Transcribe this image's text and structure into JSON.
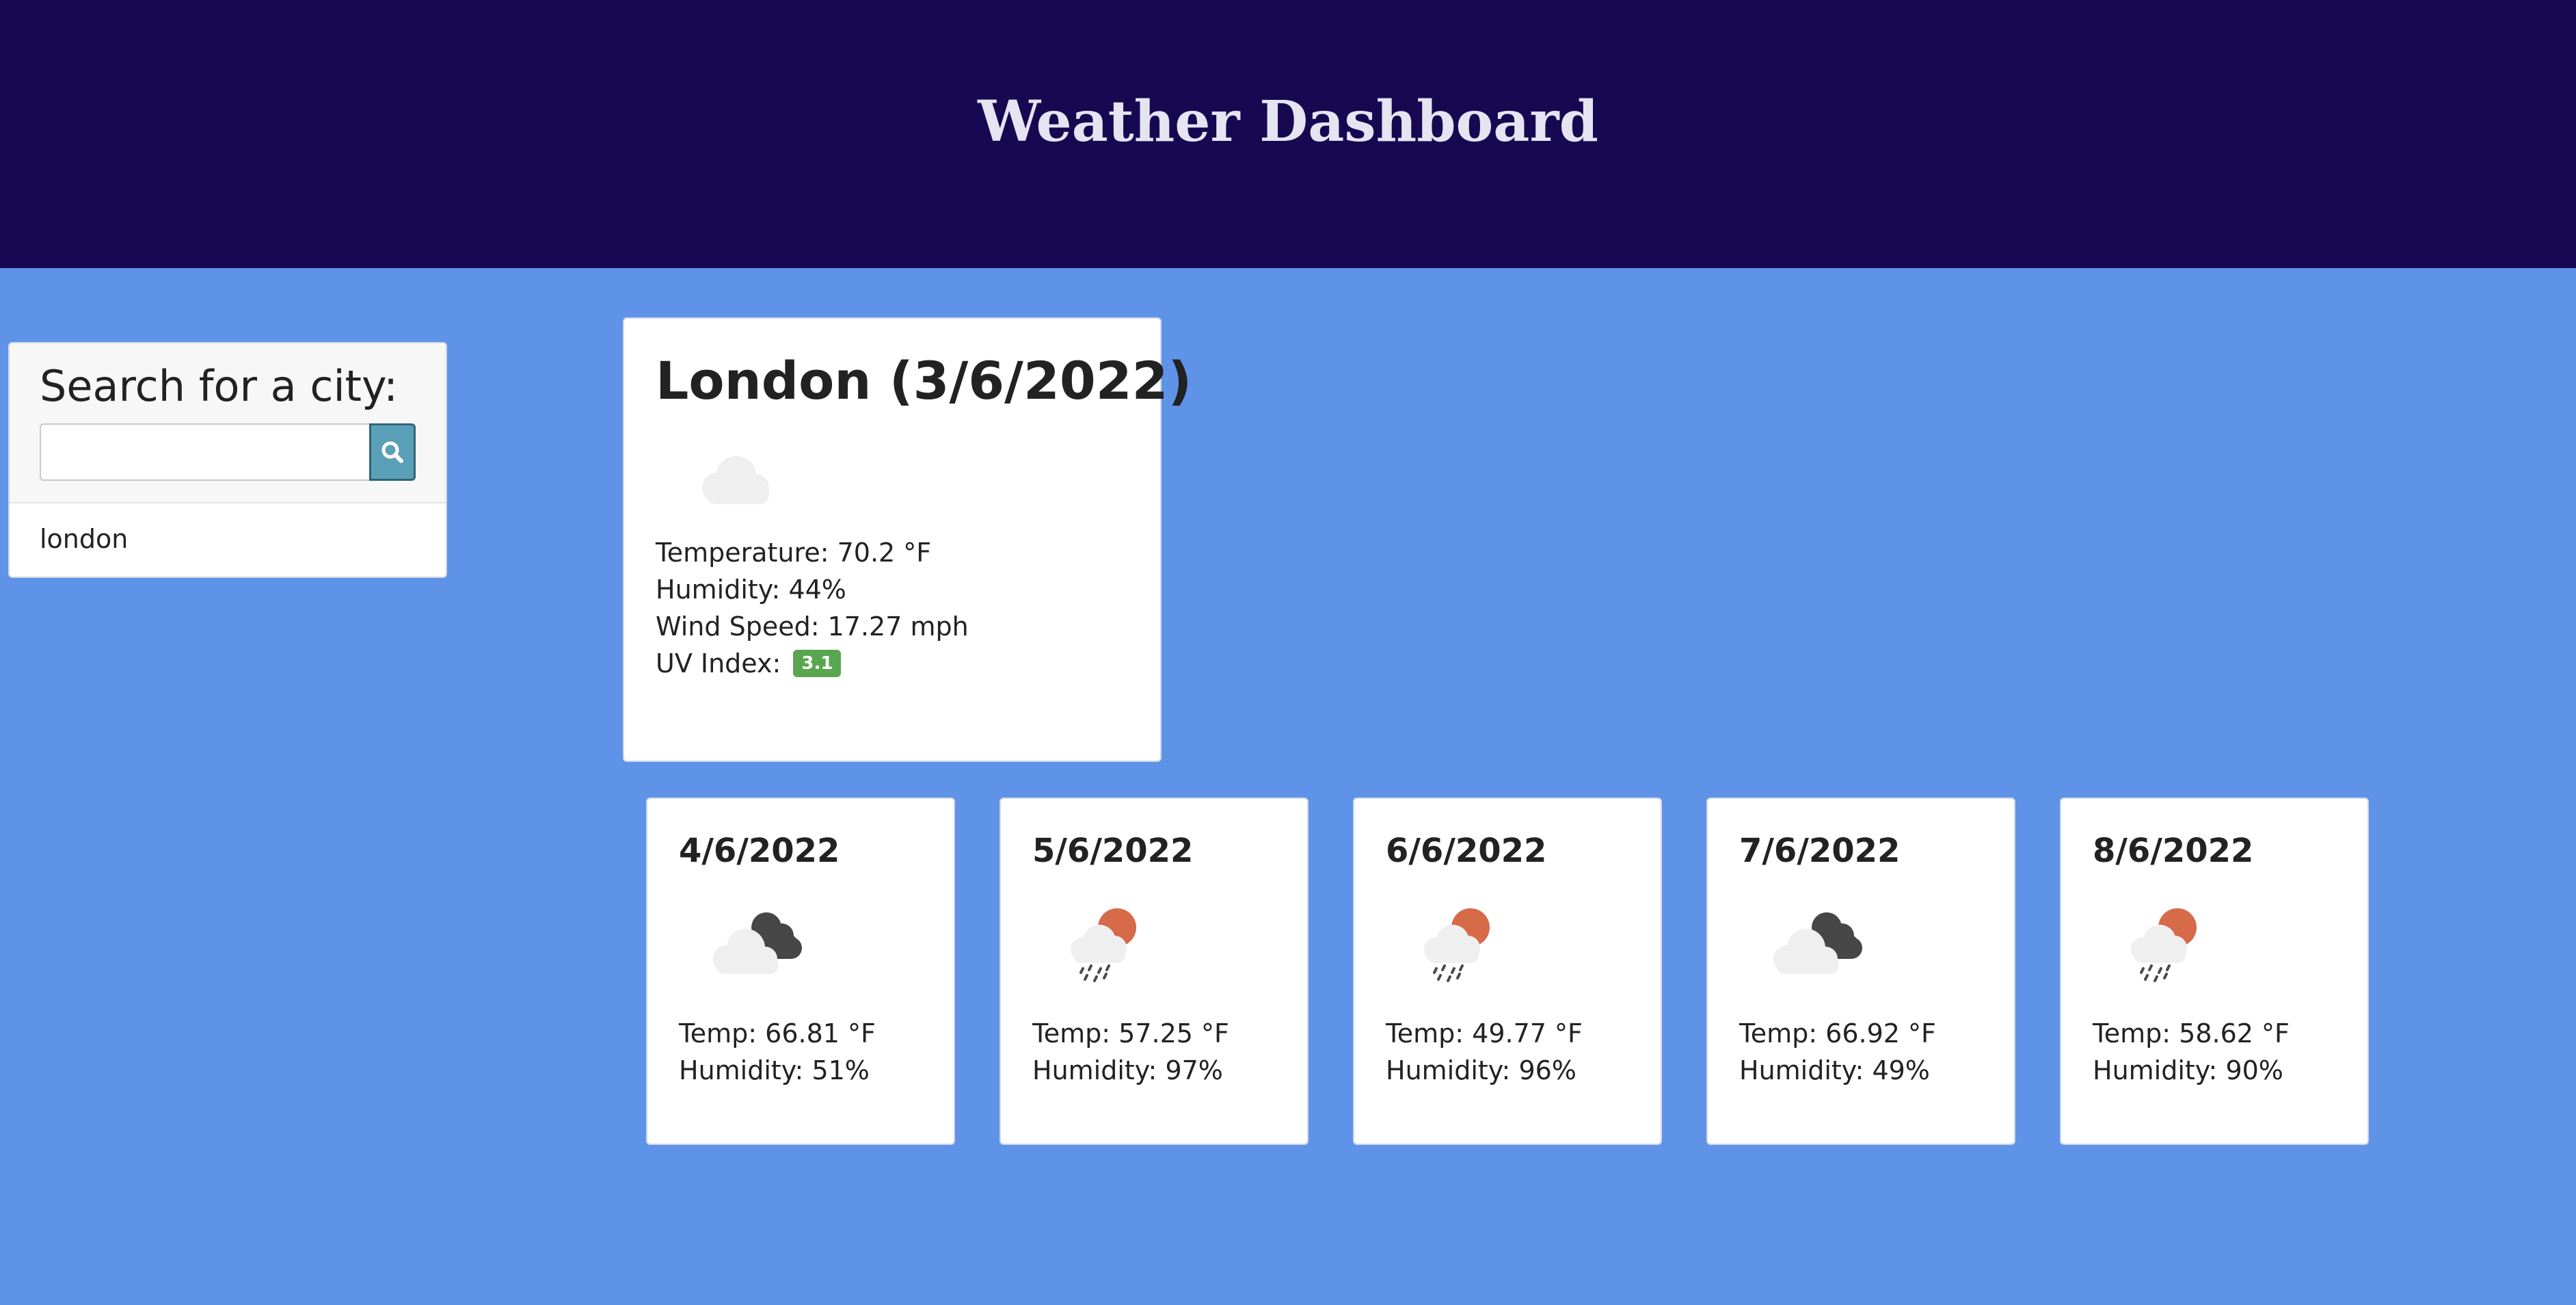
{
  "header": {
    "title": "Weather Dashboard"
  },
  "search": {
    "title": "Search for a city:",
    "input_value": "",
    "input_placeholder": "",
    "button_icon": "search-icon",
    "history": [
      "london"
    ]
  },
  "current": {
    "title": "London (3/6/2022)",
    "icon": "cloud-icon",
    "temperature_label": "Temperature:",
    "temperature_value": "70.2 °F",
    "humidity_label": "Humidity:",
    "humidity_value": "44%",
    "wind_label": "Wind Speed:",
    "wind_value": "17.27 mph",
    "uv_label": "UV Index:",
    "uv_value": "3.1",
    "uv_color": "#5aa650"
  },
  "forecast": [
    {
      "date": "4/6/2022",
      "icon": "broken-clouds-icon",
      "temp_label": "Temp:",
      "temp": "66.81 °F",
      "humidity_label": "Humidity:",
      "humidity": "51%"
    },
    {
      "date": "5/6/2022",
      "icon": "sun-rain-icon",
      "temp_label": "Temp:",
      "temp": "57.25 °F",
      "humidity_label": "Humidity:",
      "humidity": "97%"
    },
    {
      "date": "6/6/2022",
      "icon": "sun-rain-icon",
      "temp_label": "Temp:",
      "temp": "49.77 °F",
      "humidity_label": "Humidity:",
      "humidity": "96%"
    },
    {
      "date": "7/6/2022",
      "icon": "broken-clouds-icon",
      "temp_label": "Temp:",
      "temp": "66.92 °F",
      "humidity_label": "Humidity:",
      "humidity": "49%"
    },
    {
      "date": "8/6/2022",
      "icon": "sun-rain-icon",
      "temp_label": "Temp:",
      "temp": "58.62 °F",
      "humidity_label": "Humidity:",
      "humidity": "90%"
    }
  ],
  "colors": {
    "page_background": "#5f93e8",
    "header_background": "#170852",
    "header_text": "#e5e5f2",
    "search_button": "#5aa0b8"
  }
}
